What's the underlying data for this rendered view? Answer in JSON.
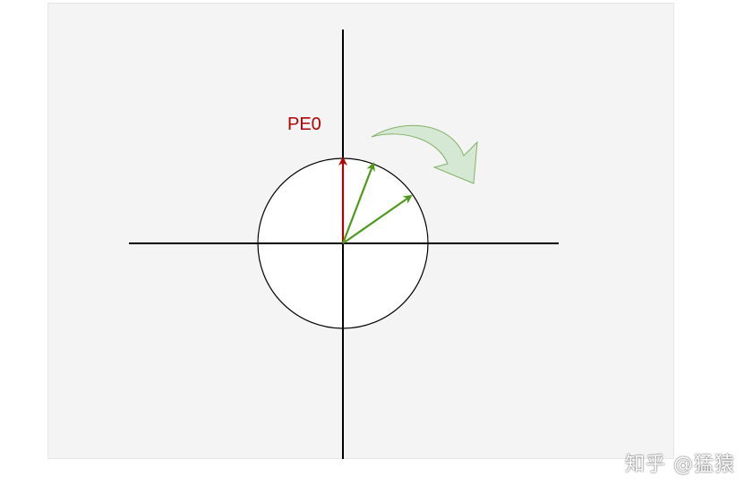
{
  "diagram": {
    "label_pe0": "PE0",
    "colors": {
      "panel_background": "#f4f4f4",
      "axis": "#000000",
      "circle_fill": "#ffffff",
      "pe0_vector": "#b20000",
      "rotated_vectors": "#4d9a1a",
      "rotation_arrow_fill": "#d5e8d4",
      "rotation_arrow_stroke": "#82b366"
    }
  },
  "watermark": {
    "text": "知乎 @猛猿"
  }
}
